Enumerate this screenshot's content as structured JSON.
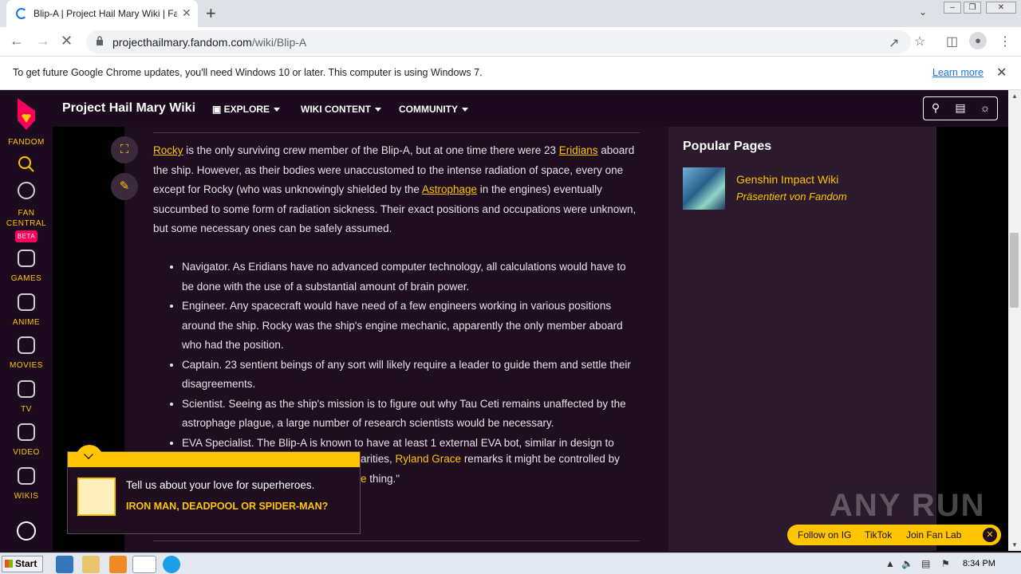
{
  "browser": {
    "tab_title": "Blip-A | Project Hail Mary Wiki | Fandom",
    "new_tab": "+",
    "tab_close": "✕",
    "url_host": "projecthailmary.fandom.com",
    "url_path": "/wiki/Blip-A"
  },
  "infobar": {
    "message": "To get future Google Chrome updates, you'll need Windows 10 or later. This computer is using Windows 7.",
    "learn_more": "Learn more"
  },
  "rail": {
    "brand": "FANDOM",
    "fan_central_1": "FAN",
    "fan_central_2": "CENTRAL",
    "beta": "BETA",
    "games": "GAMES",
    "anime": "ANIME",
    "movies": "MOVIES",
    "tv": "TV",
    "video": "VIDEO",
    "wikis": "WIKIS"
  },
  "wikibar": {
    "name": "Project Hail Mary Wiki",
    "explore": "EXPLORE",
    "wiki_content": "WIKI CONTENT",
    "community": "COMMUNITY"
  },
  "article": {
    "p1_link1": "Rocky",
    "p1_t1": " is the only surviving crew member of the Blip-A, but at one time there were 23 ",
    "p1_link2": "Eridians",
    "p1_t2": " aboard the ship. However, as their bodies were unaccustomed to the intense radiation of space, every one except for Rocky (who was unknowingly shielded by the ",
    "p1_link3": "Astrophage",
    "p1_t3": " in the engines) eventually succumbed to some form of radiation sickness. Their exact positions and occupations were unknown, but some necessary ones can be safely assumed.",
    "roles": [
      "Navigator. As Eridians have no advanced computer technology, all calculations would have to be done with the use of a substantial amount of brain power.",
      "Engineer. Any spacecraft would have need of a few engineers working in various positions around the ship. Rocky was the ship's engine mechanic, apparently the only member aboard who had the position.",
      "Captain. 23 sentient beings of any sort will likely require a leader to guide them and settle their disagreements.",
      "Scientist. Seeing as the ship's mission is to figure out why Tau Ceti remains unaffected by the astrophage plague, a large number of research scientists would be necessary."
    ],
    "eva_line1": "EVA Specialist. The Blip-A is known to have at least 1 external EVA bot, similar in design to",
    "eva_line2_pre": "arities, ",
    "eva_link": "Ryland Grace",
    "eva_line2_post": " remarks it might be controlled by",
    "eva_line3_frag": "e",
    "eva_line3_post": " thing.\""
  },
  "sidebar": {
    "popular_title": "Popular Pages",
    "item_name": "Genshin Impact Wiki",
    "item_sub": "Präsentiert von Fandom"
  },
  "promo": {
    "question": "Tell us about your love for superheroes.",
    "answer": "IRON MAN, DEADPOOL OR SPIDER-MAN?"
  },
  "follow": {
    "ig": "Follow on IG",
    "tiktok": "TikTok",
    "fanlab": "Join Fan Lab"
  },
  "watermark": "ANY RUN",
  "taskbar": {
    "start": "Start",
    "clock": "8:34 PM"
  },
  "colors": {
    "fandom_yellow": "#ffc500",
    "fandom_pink": "#fa005a",
    "page_bg": "#1e0e20",
    "chrome_blue": "#1a73e8"
  }
}
